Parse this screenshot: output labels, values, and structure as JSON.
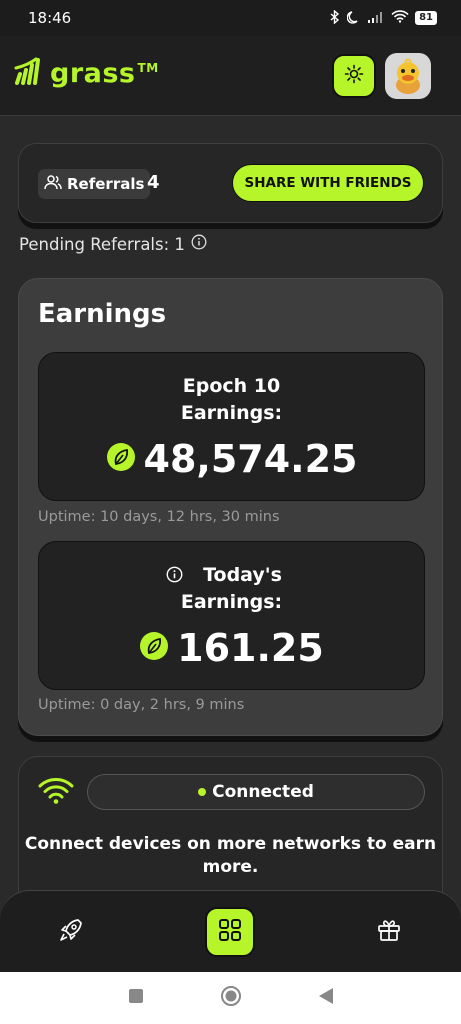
{
  "status_bar": {
    "time": "18:46",
    "battery": "81"
  },
  "header": {
    "logo_text": "grass",
    "logo_tm": "TM"
  },
  "referrals": {
    "label": "Referrals",
    "count": "4",
    "share_label": "SHARE WITH FRIENDS",
    "pending_label": "Pending Referrals: 1"
  },
  "earnings": {
    "title": "Earnings",
    "epoch_label_line1": "Epoch 10",
    "epoch_label_line2": "Earnings:",
    "epoch_amount": "48,574.25",
    "epoch_uptime": "Uptime: 10 days, 12 hrs, 30 mins",
    "today_label_line1": "Today's",
    "today_label_line2": "Earnings:",
    "today_amount": "161.25",
    "today_uptime": "Uptime: 0 day, 2 hrs, 9 mins"
  },
  "connection": {
    "status": "Connected",
    "message": "Connect devices on more networks to earn more."
  },
  "bottom_nav": [
    {
      "icon": "rocket-icon"
    },
    {
      "icon": "grid-icon",
      "active": true
    },
    {
      "icon": "gift-icon"
    }
  ],
  "colors": {
    "accent": "#b6f52a",
    "background": "#2a2a2a",
    "card": "#3d3d3d"
  }
}
